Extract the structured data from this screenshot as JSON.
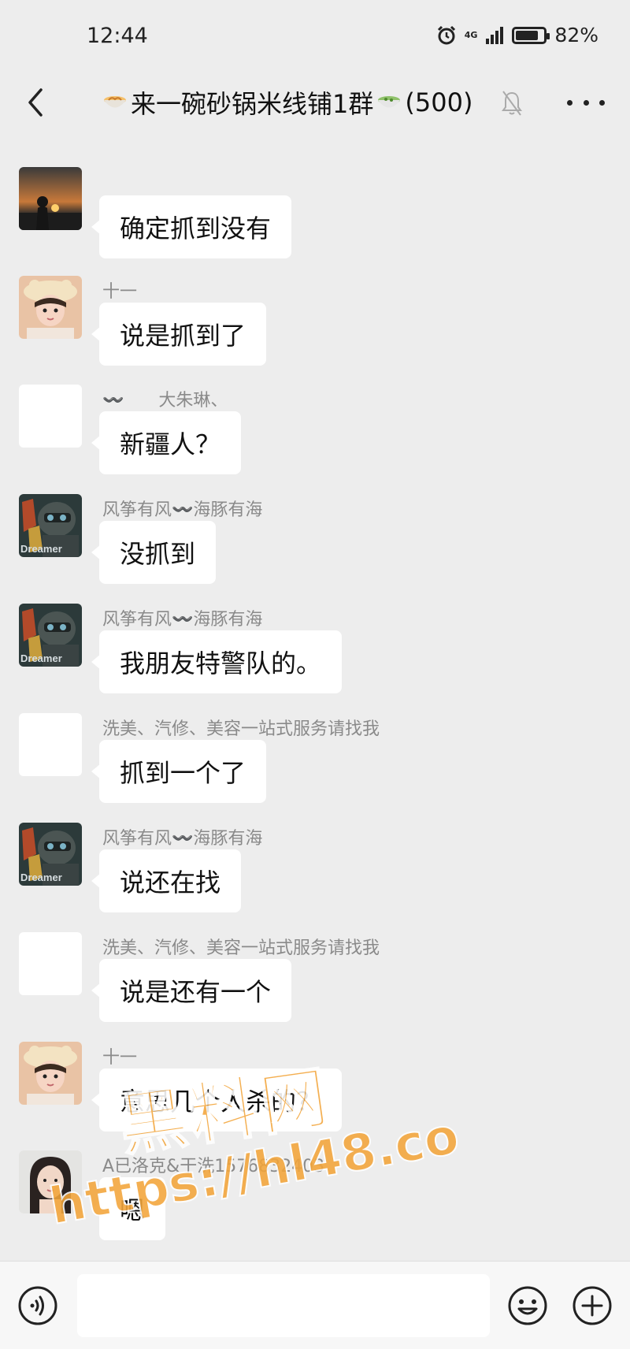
{
  "status_bar": {
    "time": "12:44",
    "network": "4G",
    "battery": "82%",
    "battery_level": 0.82
  },
  "title_bar": {
    "title": "来一碗砂锅米线铺1群",
    "count": "(500)"
  },
  "messages": [
    {
      "sender": "",
      "text": "确定抓到没有",
      "avatar": "sunset-silhouette"
    },
    {
      "sender": "十一",
      "text": "说是抓到了",
      "avatar": "girl-with-hat"
    },
    {
      "sender": "〰️　　大朱琳、",
      "text": "新疆人？",
      "avatar": "blank"
    },
    {
      "sender": "风筝有风〰️海豚有海",
      "text": "没抓到",
      "avatar": "dreamer-gamer"
    },
    {
      "sender": "风筝有风〰️海豚有海",
      "text": "我朋友特警队的。",
      "avatar": "dreamer-gamer"
    },
    {
      "sender": "洗美、汽修、美容一站式服务请找我",
      "text": "抓到一个了",
      "avatar": "blank"
    },
    {
      "sender": "风筝有风〰️海豚有海",
      "text": "说还在找",
      "avatar": "dreamer-gamer"
    },
    {
      "sender": "洗美、汽修、美容一站式服务请找我",
      "text": "说是还有一个",
      "avatar": "blank"
    },
    {
      "sender": "十一",
      "text": "意思几个人杀的？",
      "avatar": "girl-with-hat"
    },
    {
      "sender": "A已洛克&干洗1576832403",
      "text": "嗯",
      "avatar": "woman-portrait"
    }
  ],
  "avatar_labels": {
    "dreamer": "Dreamer"
  },
  "watermark": {
    "line1": "黑料网",
    "line2": "https://hl48.co"
  },
  "colors": {
    "background": "#ededed",
    "bubble": "#ffffff",
    "watermark": "#f3a53a"
  }
}
